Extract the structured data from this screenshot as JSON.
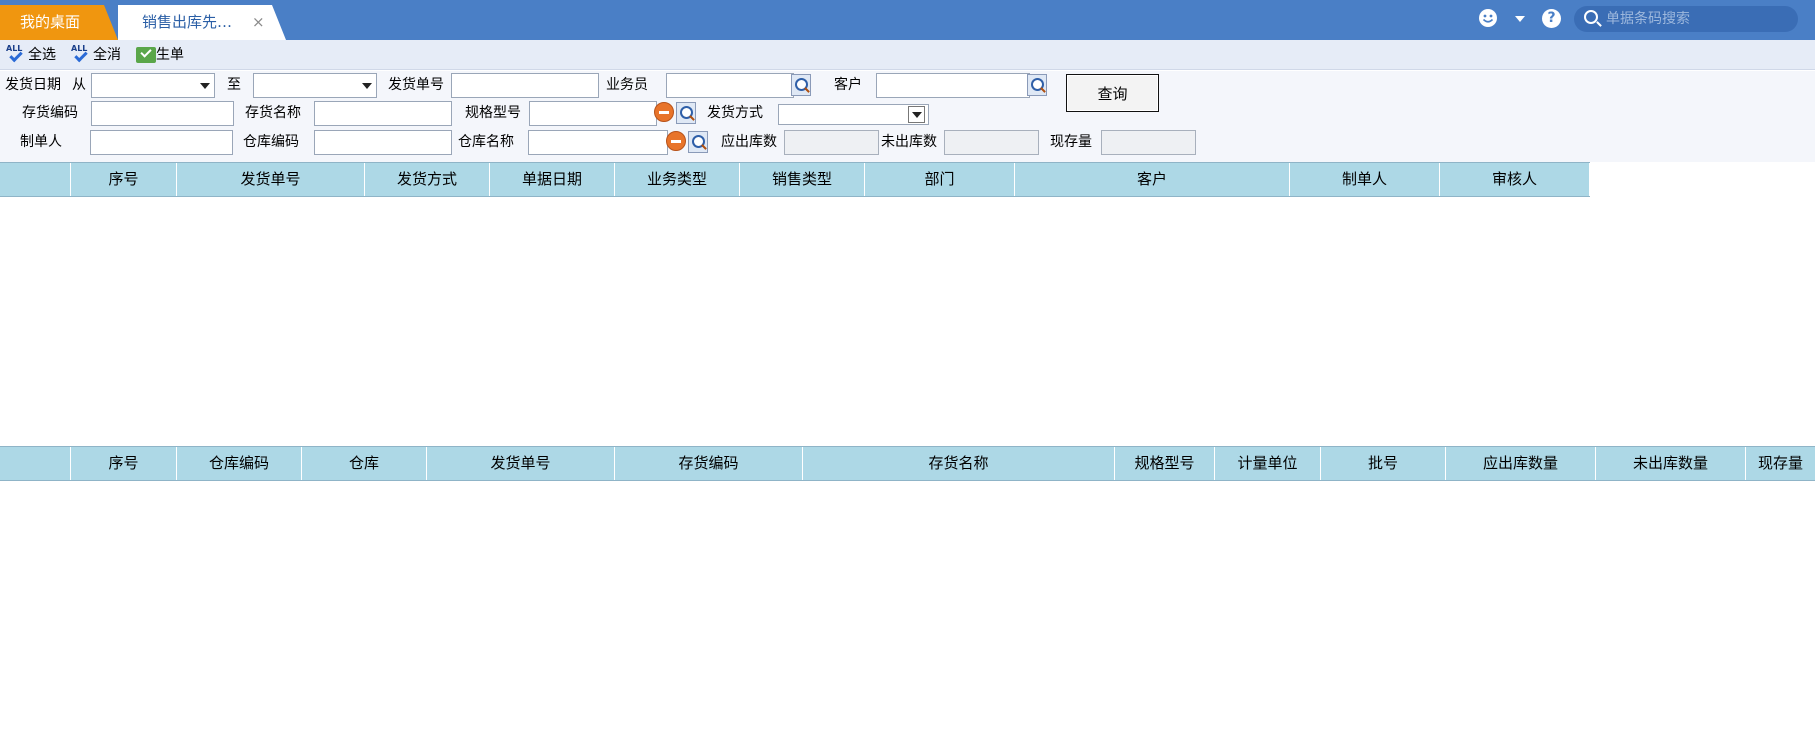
{
  "tabs": {
    "home": "我的桌面",
    "active": "销售出库先…",
    "close": "×"
  },
  "topbar": {
    "search_placeholder": "单据条码搜索",
    "help": "?"
  },
  "toolbar": {
    "select_all": "全选",
    "deselect_all": "全消",
    "generate": "生单",
    "all_badge": "ALL"
  },
  "filter": {
    "ship_date": "发货日期",
    "from": "从",
    "to": "至",
    "ship_no": "发货单号",
    "salesman": "业务员",
    "customer": "客户",
    "query": "查询",
    "inv_code": "存货编码",
    "inv_name": "存货名称",
    "spec": "规格型号",
    "ship_method": "发货方式",
    "maker": "制单人",
    "wh_code": "仓库编码",
    "wh_name": "仓库名称",
    "should_out": "应出库数",
    "not_out": "未出库数",
    "stock": "现存量"
  },
  "upper_grid": {
    "columns": [
      "",
      "序号",
      "发货单号",
      "发货方式",
      "单据日期",
      "业务类型",
      "销售类型",
      "部门",
      "客户",
      "制单人",
      "审核人"
    ],
    "rows": []
  },
  "lower_grid": {
    "columns": [
      "",
      "序号",
      "仓库编码",
      "仓库",
      "发货单号",
      "存货编码",
      "存货名称",
      "规格型号",
      "计量单位",
      "批号",
      "应出库数量",
      "未出库数量",
      "现存量"
    ],
    "rows": []
  },
  "colors": {
    "topbar": "#4a7fc6",
    "home_tab": "#f0960f",
    "grid_header": "#add8e6"
  }
}
